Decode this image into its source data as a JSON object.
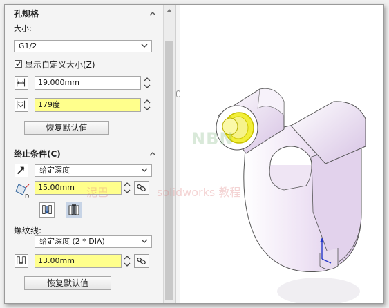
{
  "hole_spec": {
    "title": "孔规格",
    "size_label": "大小:",
    "size_value": "G1/2",
    "custom_size_checkbox_label": "显示自定义大小(Z)",
    "custom_size_checked": true,
    "diameter_value": "19.000mm",
    "angle_value": "179度",
    "restore_button": "恢复默认值"
  },
  "end_condition": {
    "title": "终止条件(C)",
    "type_value": "给定深度",
    "depth_value": "15.00mm",
    "depth_marker": "D",
    "thread_label": "螺纹线:",
    "thread_type_value": "给定深度 (2 * DIA)",
    "thread_depth_value": "13.00mm",
    "restore_button": "恢复默认值"
  },
  "watermark": {
    "brand": "NBN",
    "text_cn": "泥巴",
    "text_en": "solidworks 教程"
  },
  "colors": {
    "highlight_yellow": "#ffff8c",
    "model_pink": "#e9ddf1",
    "selection_yellow": "#f2ef3a"
  },
  "icons": {
    "diameter": "diameter-icon",
    "angle": "countersink-angle-icon",
    "direction": "reverse-direction-icon",
    "depth": "depth-icon",
    "link": "link-icon",
    "thread_depth": "thread-depth-icon"
  }
}
